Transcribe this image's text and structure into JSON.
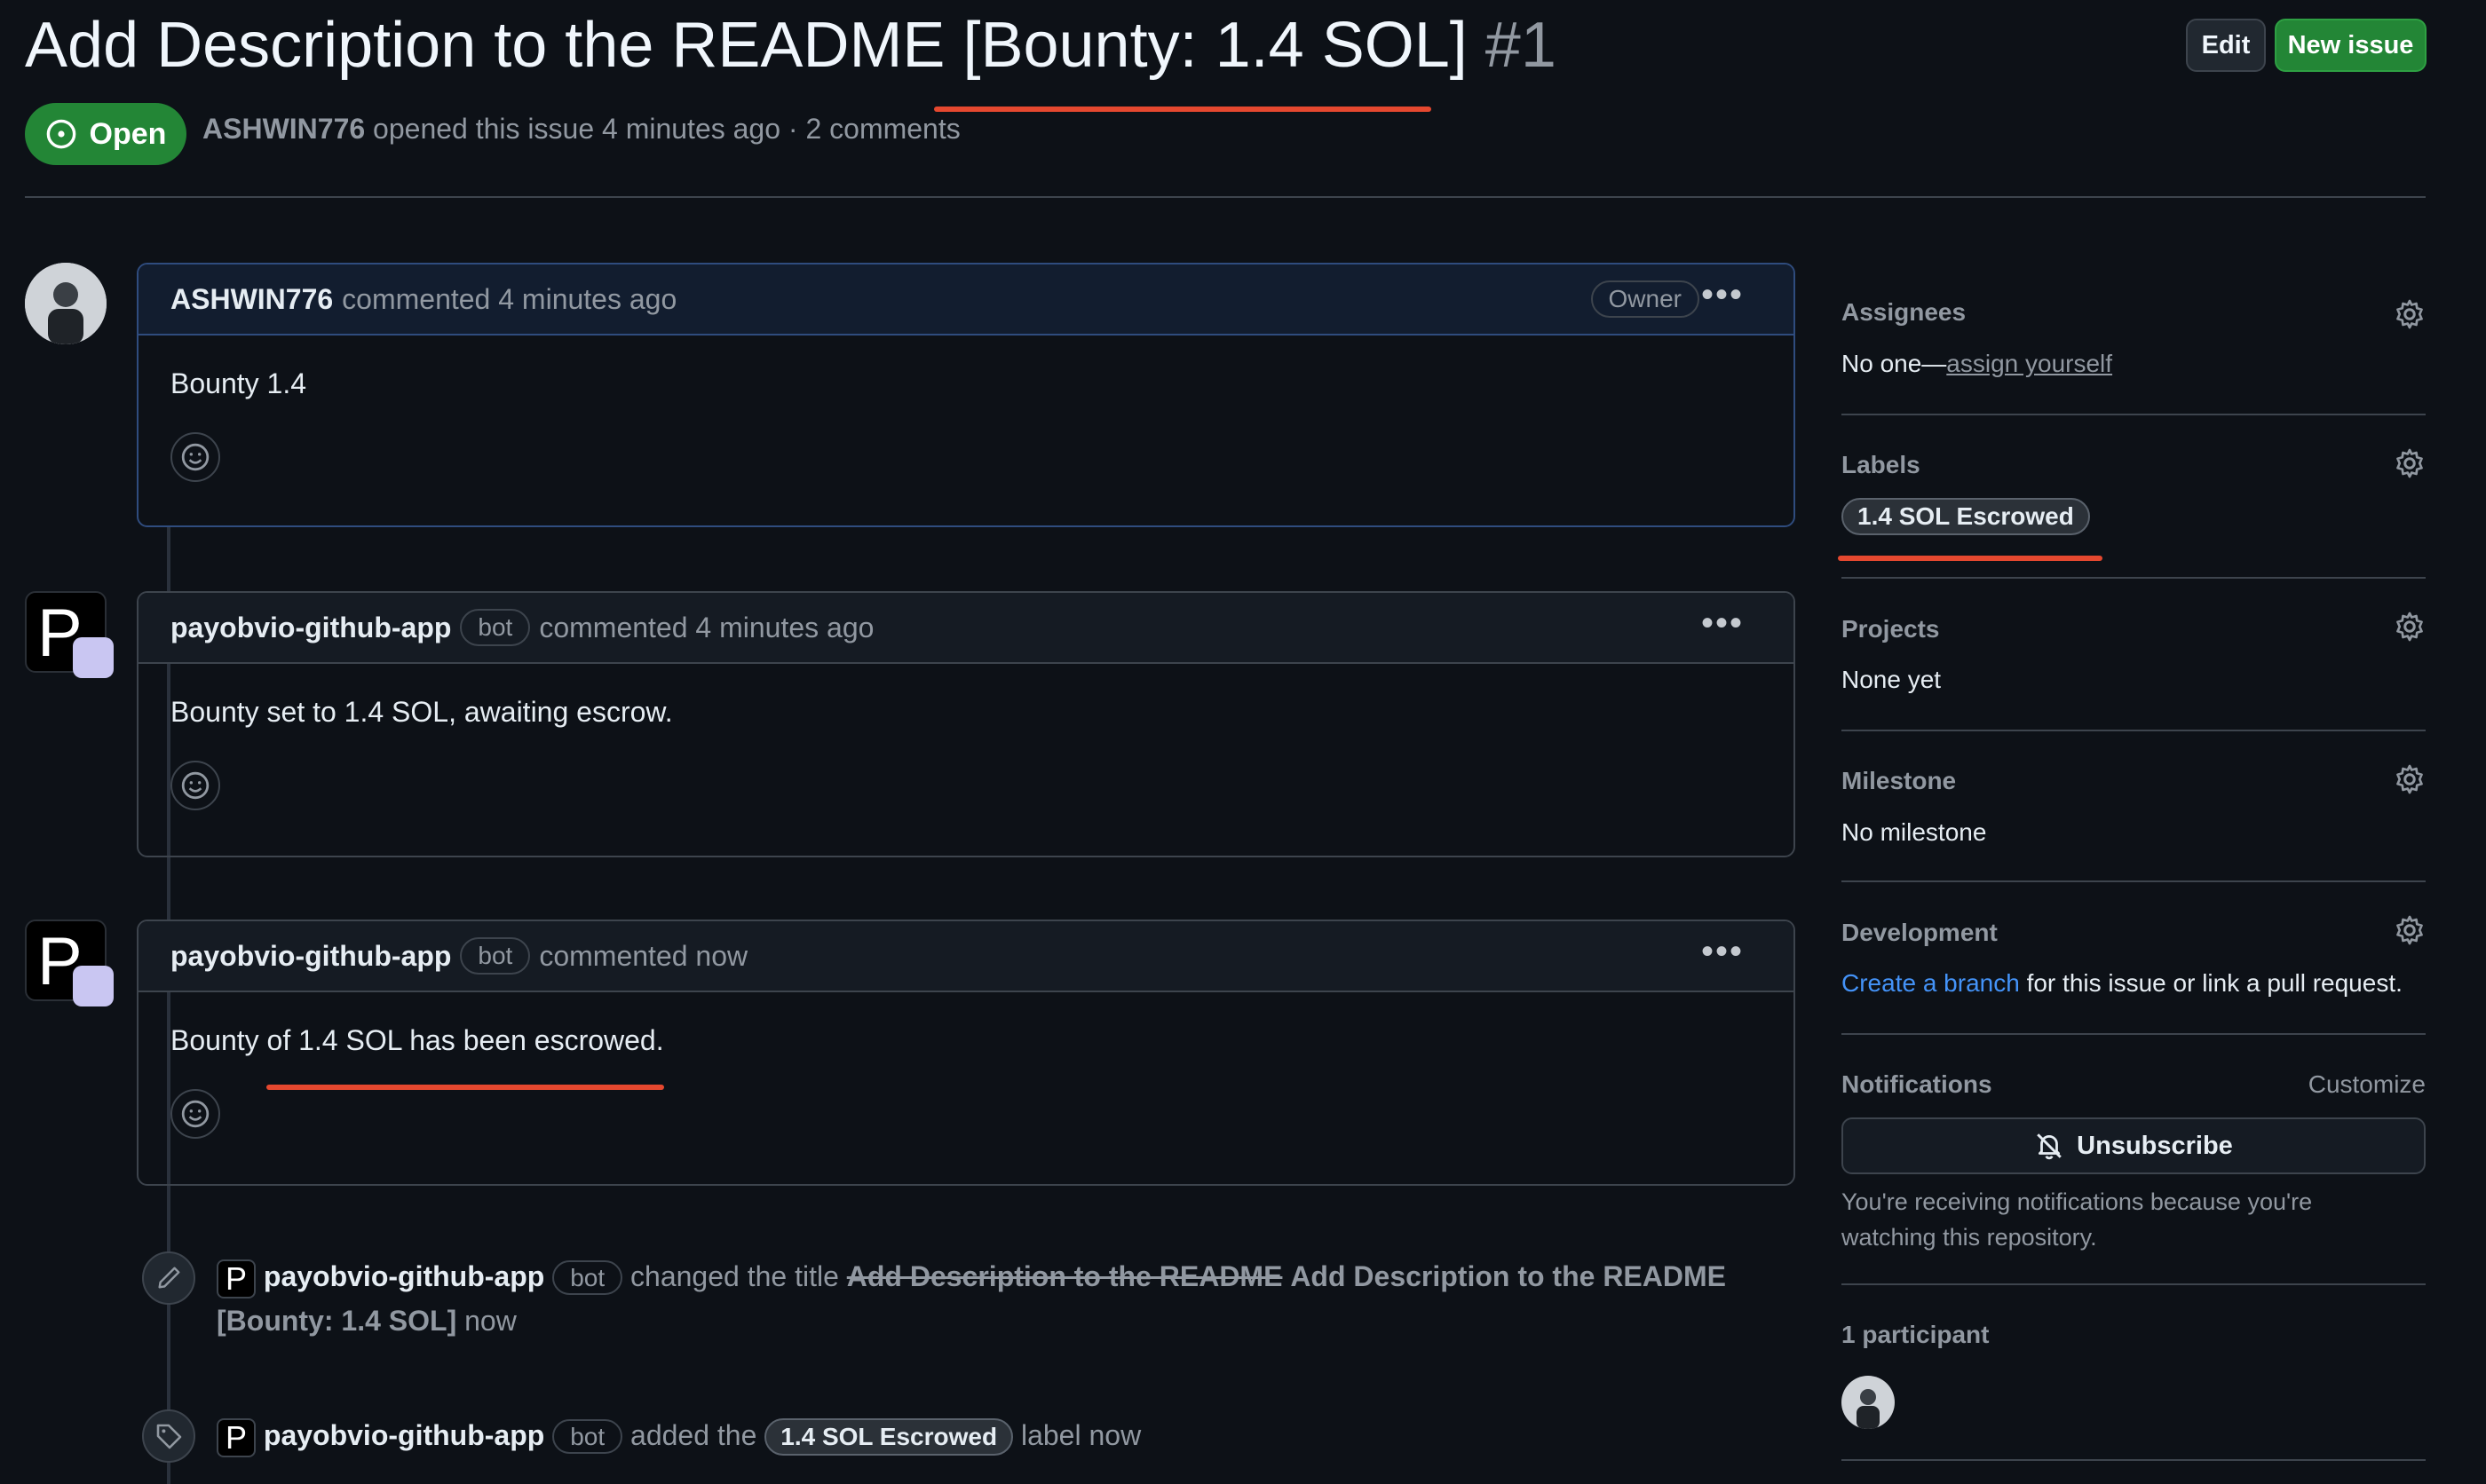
{
  "issue": {
    "title": "Add Description to the README [Bounty: 1.4 SOL]",
    "number": "#1",
    "status": "Open",
    "author": "ASHWIN776",
    "meta_text": "opened this issue 4 minutes ago · 2 comments"
  },
  "toolbar": {
    "edit_label": "Edit",
    "new_issue_label": "New issue"
  },
  "comments": [
    {
      "author": "ASHWIN776",
      "action": "commented 4 minutes ago",
      "badge": "Owner",
      "body": "Bounty 1.4"
    },
    {
      "author": "payobvio-github-app",
      "badge": "bot",
      "action": "commented 4 minutes ago",
      "body": "Bounty set to 1.4 SOL, awaiting escrow."
    },
    {
      "author": "payobvio-github-app",
      "badge": "bot",
      "action": "commented now",
      "body": "Bounty of 1.4 SOL has been escrowed."
    }
  ],
  "avatar_letter": "P",
  "events": [
    {
      "author": "payobvio-github-app",
      "badge": "bot",
      "action": "changed the title",
      "old_title": "Add Description to the README",
      "new_title_1": "Add Description to the README",
      "new_title_2": "[Bounty: 1.4 SOL]",
      "time": "now"
    },
    {
      "author": "payobvio-github-app",
      "badge": "bot",
      "action": "added the",
      "label": "1.4 SOL Escrowed",
      "suffix": "label now"
    }
  ],
  "sidebar": {
    "assignees": {
      "label": "Assignees",
      "value_prefix": "No one—",
      "value_link": "assign yourself"
    },
    "labels": {
      "label": "Labels",
      "value": "1.4 SOL Escrowed"
    },
    "projects": {
      "label": "Projects",
      "value": "None yet"
    },
    "milestone": {
      "label": "Milestone",
      "value": "No milestone"
    },
    "development": {
      "label": "Development",
      "link": "Create a branch",
      "suffix": "for this issue or link a pull request."
    },
    "notifications": {
      "label": "Notifications",
      "customize": "Customize",
      "button": "Unsubscribe",
      "note_line1": "You're receiving notifications because you're",
      "note_line2": "watching this repository."
    },
    "participants": {
      "label": "1 participant"
    }
  },
  "colors": {
    "accent_green": "#238636",
    "link_blue": "#4493f8",
    "annotation_red": "#e5482f"
  }
}
